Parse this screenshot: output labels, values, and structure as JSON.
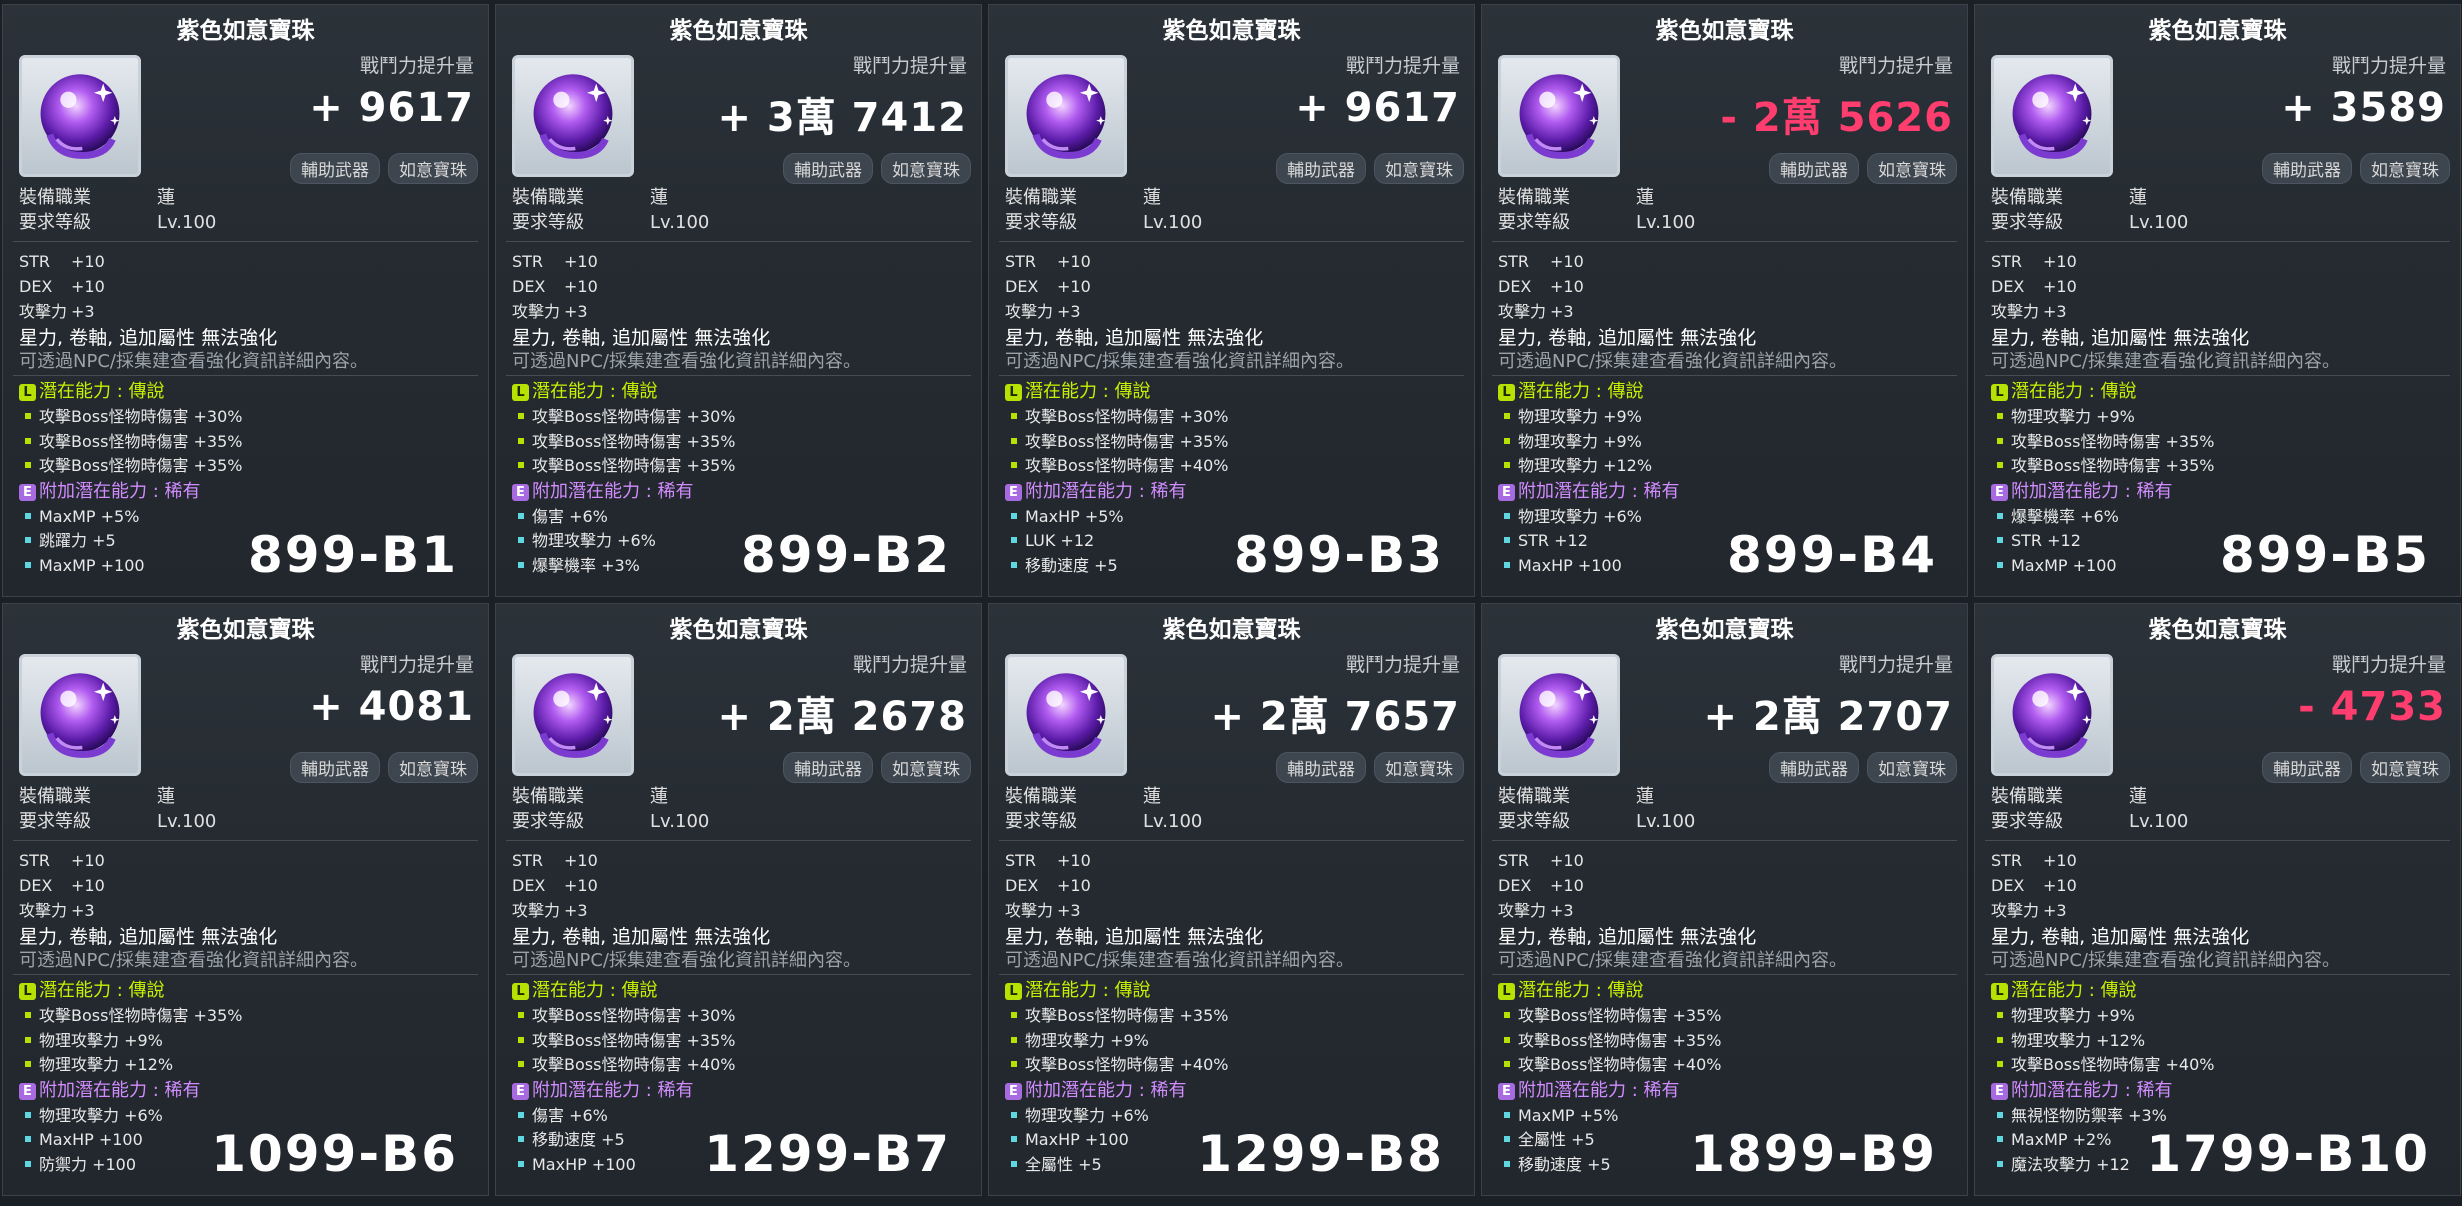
{
  "labels": {
    "cp_label": "戰鬥力提升量",
    "tag_secondary": "輔助武器",
    "tag_orb": "如意寶珠",
    "job_label": "裝備職業",
    "job_value": "蓮",
    "level_label": "要求等級",
    "level_value": "Lv.100",
    "note_line1": "星力, 卷軸, 追加屬性 無法強化",
    "note_line2": "可透過NPC/採集建查看強化資訊詳細內容。",
    "potential_title": "潛在能力 : 傳說",
    "additional_title": "附加潛在能力 : 稀有",
    "badge_potential": "L",
    "badge_additional": "E"
  },
  "cards": [
    {
      "title": "紫色如意寶珠",
      "cp": "+ 9617",
      "cp_negative": false,
      "stats": [
        {
          "name": "STR",
          "value": "+10"
        },
        {
          "name": "DEX",
          "value": "+10"
        },
        {
          "name": "攻擊力",
          "value": "+3"
        }
      ],
      "potential": [
        "攻擊Boss怪物時傷害 +30%",
        "攻擊Boss怪物時傷害 +35%",
        "攻擊Boss怪物時傷害 +35%"
      ],
      "additional": [
        "MaxMP +5%",
        "跳躍力 +5",
        "MaxMP +100"
      ],
      "code": "899-B1"
    },
    {
      "title": "紫色如意寶珠",
      "cp": "+ 3萬 7412",
      "cp_negative": false,
      "stats": [
        {
          "name": "STR",
          "value": "+10"
        },
        {
          "name": "DEX",
          "value": "+10"
        },
        {
          "name": "攻擊力",
          "value": "+3"
        }
      ],
      "potential": [
        "攻擊Boss怪物時傷害 +30%",
        "攻擊Boss怪物時傷害 +35%",
        "攻擊Boss怪物時傷害 +35%"
      ],
      "additional": [
        "傷害 +6%",
        "物理攻擊力 +6%",
        "爆擊機率 +3%"
      ],
      "code": "899-B2"
    },
    {
      "title": "紫色如意寶珠",
      "cp": "+ 9617",
      "cp_negative": false,
      "stats": [
        {
          "name": "STR",
          "value": "+10"
        },
        {
          "name": "DEX",
          "value": "+10"
        },
        {
          "name": "攻擊力",
          "value": "+3"
        }
      ],
      "potential": [
        "攻擊Boss怪物時傷害 +30%",
        "攻擊Boss怪物時傷害 +35%",
        "攻擊Boss怪物時傷害 +40%"
      ],
      "additional": [
        "MaxHP +5%",
        "LUK +12",
        "移動速度 +5"
      ],
      "code": "899-B3"
    },
    {
      "title": "紫色如意寶珠",
      "cp": "- 2萬 5626",
      "cp_negative": true,
      "stats": [
        {
          "name": "STR",
          "value": "+10"
        },
        {
          "name": "DEX",
          "value": "+10"
        },
        {
          "name": "攻擊力",
          "value": "+3"
        }
      ],
      "potential": [
        "物理攻擊力 +9%",
        "物理攻擊力 +9%",
        "物理攻擊力 +12%"
      ],
      "additional": [
        "物理攻擊力 +6%",
        "STR +12",
        "MaxHP +100"
      ],
      "code": "899-B4"
    },
    {
      "title": "紫色如意寶珠",
      "cp": "+ 3589",
      "cp_negative": false,
      "stats": [
        {
          "name": "STR",
          "value": "+10"
        },
        {
          "name": "DEX",
          "value": "+10"
        },
        {
          "name": "攻擊力",
          "value": "+3"
        }
      ],
      "potential": [
        "物理攻擊力 +9%",
        "攻擊Boss怪物時傷害 +35%",
        "攻擊Boss怪物時傷害 +35%"
      ],
      "additional": [
        "爆擊機率 +6%",
        "STR +12",
        "MaxMP +100"
      ],
      "code": "899-B5"
    },
    {
      "title": "紫色如意寶珠",
      "cp": "+ 4081",
      "cp_negative": false,
      "stats": [
        {
          "name": "STR",
          "value": "+10"
        },
        {
          "name": "DEX",
          "value": "+10"
        },
        {
          "name": "攻擊力",
          "value": "+3"
        }
      ],
      "potential": [
        "攻擊Boss怪物時傷害 +35%",
        "物理攻擊力 +9%",
        "物理攻擊力 +12%"
      ],
      "additional": [
        "物理攻擊力 +6%",
        "MaxHP +100",
        "防禦力 +100"
      ],
      "code": "1099-B6"
    },
    {
      "title": "紫色如意寶珠",
      "cp": "+ 2萬 2678",
      "cp_negative": false,
      "stats": [
        {
          "name": "STR",
          "value": "+10"
        },
        {
          "name": "DEX",
          "value": "+10"
        },
        {
          "name": "攻擊力",
          "value": "+3"
        }
      ],
      "potential": [
        "攻擊Boss怪物時傷害 +30%",
        "攻擊Boss怪物時傷害 +35%",
        "攻擊Boss怪物時傷害 +40%"
      ],
      "additional": [
        "傷害 +6%",
        "移動速度 +5",
        "MaxHP +100"
      ],
      "code": "1299-B7"
    },
    {
      "title": "紫色如意寶珠",
      "cp": "+ 2萬 7657",
      "cp_negative": false,
      "stats": [
        {
          "name": "STR",
          "value": "+10"
        },
        {
          "name": "DEX",
          "value": "+10"
        },
        {
          "name": "攻擊力",
          "value": "+3"
        }
      ],
      "potential": [
        "攻擊Boss怪物時傷害 +35%",
        "物理攻擊力 +9%",
        "攻擊Boss怪物時傷害 +40%"
      ],
      "additional": [
        "物理攻擊力 +6%",
        "MaxHP +100",
        "全屬性 +5"
      ],
      "code": "1299-B8"
    },
    {
      "title": "紫色如意寶珠",
      "cp": "+ 2萬 2707",
      "cp_negative": false,
      "stats": [
        {
          "name": "STR",
          "value": "+10"
        },
        {
          "name": "DEX",
          "value": "+10"
        },
        {
          "name": "攻擊力",
          "value": "+3"
        }
      ],
      "potential": [
        "攻擊Boss怪物時傷害 +35%",
        "攻擊Boss怪物時傷害 +35%",
        "攻擊Boss怪物時傷害 +40%"
      ],
      "additional": [
        "MaxMP +5%",
        "全屬性 +5",
        "移動速度 +5"
      ],
      "code": "1899-B9"
    },
    {
      "title": "紫色如意寶珠",
      "cp": "- 4733",
      "cp_negative": true,
      "stats": [
        {
          "name": "STR",
          "value": "+10"
        },
        {
          "name": "DEX",
          "value": "+10"
        },
        {
          "name": "攻擊力",
          "value": "+3"
        }
      ],
      "potential": [
        "物理攻擊力 +9%",
        "物理攻擊力 +12%",
        "攻擊Boss怪物時傷害 +40%"
      ],
      "additional": [
        "無視怪物防禦率 +3%",
        "MaxMP +2%",
        "魔法攻擊力 +12"
      ],
      "code": "1799-B10"
    }
  ]
}
